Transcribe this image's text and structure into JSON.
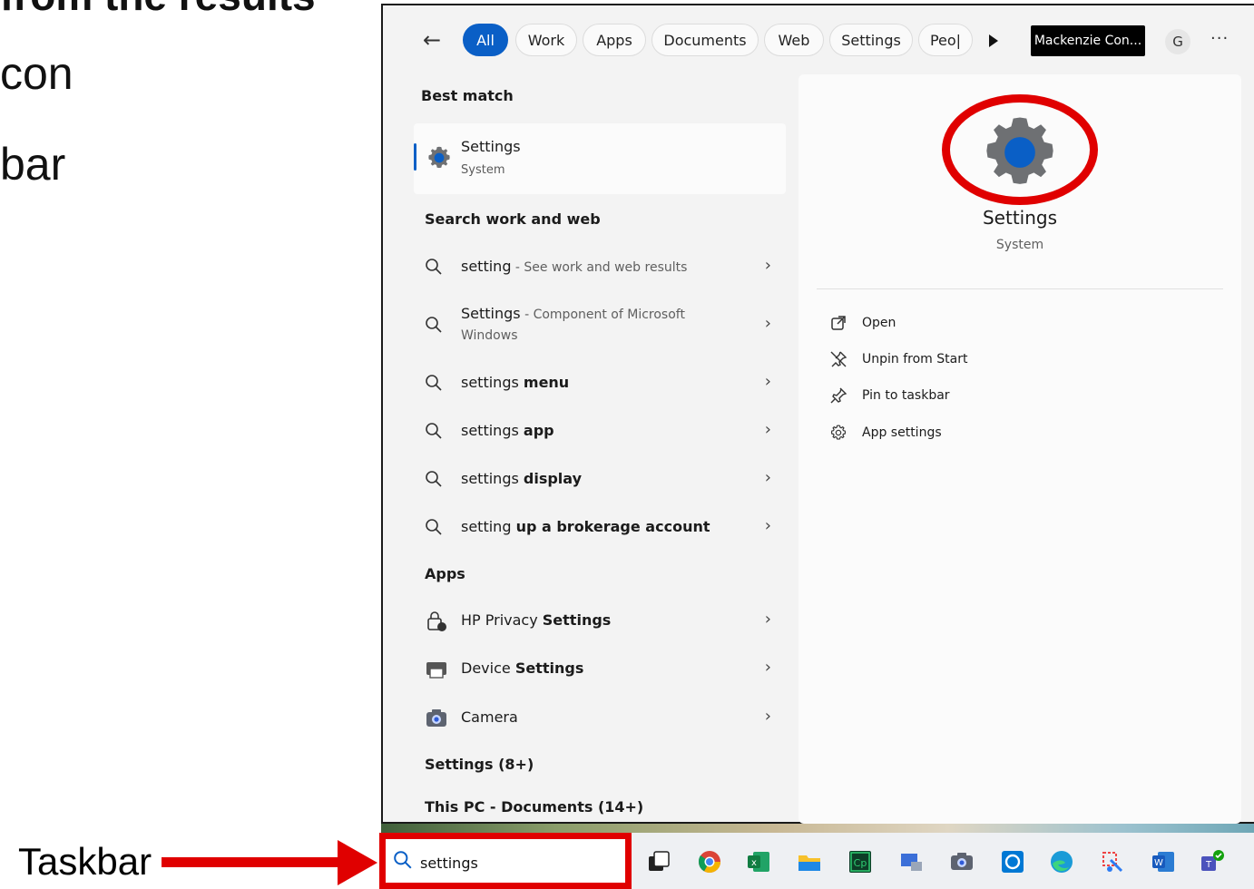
{
  "slide": {
    "line_top": "from the results",
    "line1": "con",
    "line2": "bar",
    "taskbar_label": "Taskbar"
  },
  "filters": {
    "chips": [
      "All",
      "Work",
      "Apps",
      "Documents",
      "Web",
      "Settings",
      "Peo|"
    ],
    "account": "Mackenzie Con...",
    "avatar": "G",
    "more": "···"
  },
  "results": {
    "best_match_heading": "Best match",
    "best_match": {
      "title": "Settings",
      "subtitle": "System"
    },
    "search_heading": "Search work and web",
    "search_items": [
      {
        "pre": "setting",
        "bold": "",
        "suffix": " - See work and web results"
      },
      {
        "pre": "Settings",
        "bold": "",
        "suffix": " - Component of Microsoft",
        "suffix2": "Windows"
      },
      {
        "pre": "settings ",
        "bold": "menu",
        "suffix": ""
      },
      {
        "pre": "settings ",
        "bold": "app",
        "suffix": ""
      },
      {
        "pre": "settings ",
        "bold": "display",
        "suffix": ""
      },
      {
        "pre": "setting ",
        "bold": "up a brokerage account",
        "suffix": ""
      }
    ],
    "apps_heading": "Apps",
    "apps": [
      {
        "pre": "HP Privacy ",
        "bold": "Settings"
      },
      {
        "pre": "Device ",
        "bold": "Settings"
      },
      {
        "pre": "Camera",
        "bold": ""
      }
    ],
    "settings_heading": "Settings (8+)",
    "documents_heading": "This PC - Documents (14+)"
  },
  "preview": {
    "title": "Settings",
    "subtitle": "System",
    "actions": [
      "Open",
      "Unpin from Start",
      "Pin to taskbar",
      "App settings"
    ]
  },
  "taskbar": {
    "search_text": "settings"
  },
  "colors": {
    "accent": "#0a5fc6",
    "highlight": "#e00000"
  }
}
